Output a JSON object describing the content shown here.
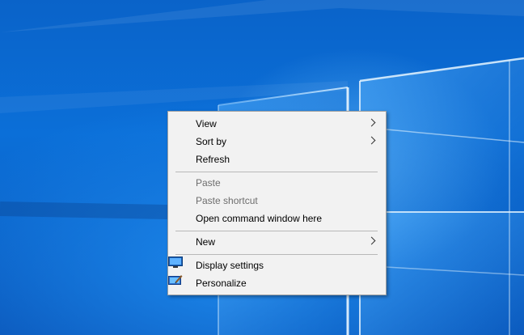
{
  "context_menu": {
    "items": [
      {
        "label": "View",
        "submenu": true,
        "enabled": true
      },
      {
        "label": "Sort by",
        "submenu": true,
        "enabled": true
      },
      {
        "label": "Refresh",
        "submenu": false,
        "enabled": true
      },
      {
        "label": "Paste",
        "submenu": false,
        "enabled": false
      },
      {
        "label": "Paste shortcut",
        "submenu": false,
        "enabled": false
      },
      {
        "label": "Open command window here",
        "submenu": false,
        "enabled": true
      },
      {
        "label": "New",
        "submenu": true,
        "enabled": true
      },
      {
        "label": "Display settings",
        "submenu": false,
        "enabled": true,
        "icon": "display-icon"
      },
      {
        "label": "Personalize",
        "submenu": false,
        "enabled": true,
        "icon": "personalize-icon"
      }
    ]
  },
  "colors": {
    "menu_background": "#f2f2f2",
    "disabled_text": "#6d6d6d",
    "desktop_blue": "#0b6fd8"
  }
}
